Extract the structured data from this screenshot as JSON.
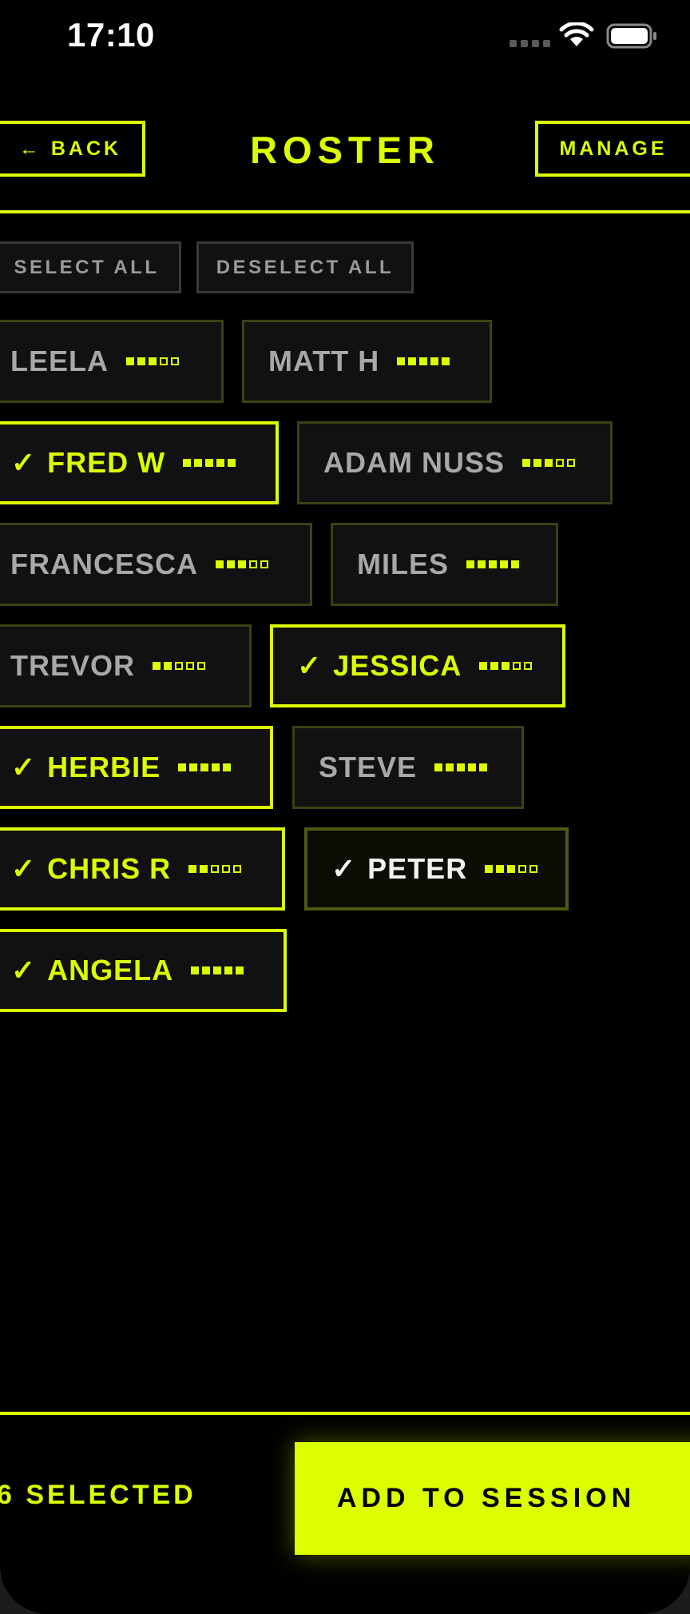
{
  "status_bar": {
    "time": "17:10"
  },
  "header": {
    "back_label": "← BACK",
    "title": "ROSTER",
    "manage_label": "MANAGE"
  },
  "selection_controls": {
    "select_all_label": "SELECT ALL",
    "deselect_all_label": "DESELECT ALL"
  },
  "players": [
    {
      "name": "LEELA",
      "selected": false,
      "rating": 3
    },
    {
      "name": "MATT H",
      "selected": false,
      "rating": 5
    },
    {
      "name": "FRED W",
      "selected": true,
      "rating": 5
    },
    {
      "name": "ADAM NUSS",
      "selected": false,
      "rating": 3
    },
    {
      "name": "FRANCESCA",
      "selected": false,
      "rating": 3
    },
    {
      "name": "MILES",
      "selected": false,
      "rating": 5
    },
    {
      "name": "TREVOR",
      "selected": false,
      "rating": 2
    },
    {
      "name": "JESSICA",
      "selected": true,
      "rating": 3
    },
    {
      "name": "HERBIE",
      "selected": true,
      "rating": 5
    },
    {
      "name": "STEVE",
      "selected": false,
      "rating": 5
    },
    {
      "name": "CHRIS R",
      "selected": true,
      "rating": 2
    },
    {
      "name": "PETER",
      "selected": true,
      "rating": 3
    },
    {
      "name": "ANGELA",
      "selected": true,
      "rating": 5
    }
  ],
  "check_glyph": "✓",
  "footer": {
    "selected_count_label": "6 SELECTED",
    "add_button_label": "ADD TO SESSION"
  },
  "colors": {
    "accent": "#dcfe00",
    "background": "#000000",
    "muted_text": "#a8a8a8"
  }
}
